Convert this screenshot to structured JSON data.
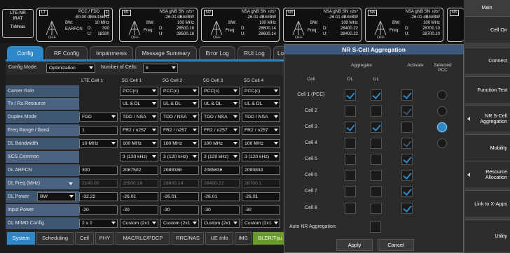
{
  "status": {
    "lte": {
      "line1": "LTE-NR",
      "line2": "IRAT",
      "line3": "TxMeas"
    },
    "pcc": {
      "tag": "LT",
      "title": "PCC / FDD",
      "badge": "1",
      "power": "-60.00 dBm/15kHz",
      "bw_label": "BW:",
      "bw": "10 MHz",
      "earfcn_label": "EARFCN",
      "d_label": "D:",
      "d": "300",
      "u_label": "U:",
      "u": "18300",
      "off": "OFF"
    },
    "cells": [
      {
        "tag": "N1",
        "title": "NSA gNB SN",
        "band": "n257",
        "power": "-26.01 dBm/BW",
        "bw_label": "BW:",
        "bw": "100 MHz",
        "freq_label": "Freq:",
        "d_label": "D:",
        "d": "28500.18",
        "u_label": "U:",
        "u": "28500.18",
        "off": "OFF"
      },
      {
        "tag": "N2",
        "title": "NSA gNB SN",
        "band": "n257",
        "power": "-26.01 dBm/BW",
        "bw_label": "BW:",
        "bw": "100 MHz",
        "freq_label": "Freq:",
        "d_label": "D:",
        "d": "28600.14",
        "u_label": "U:",
        "u": "28600.14",
        "off": "OFF"
      },
      {
        "tag": "N3",
        "title": "NSA gNB SN",
        "band": "n257",
        "power": "-26.01 dBm/BW",
        "bw_label": "BW:",
        "bw": "100 MHz",
        "freq_label": "Freq:",
        "d_label": "D:",
        "d": "28400.22",
        "u_label": "U:",
        "u": "28400.22",
        "off": "OFF"
      },
      {
        "tag": "N4",
        "title": "NSA gNB SN",
        "band": "n257",
        "power": "-26.01 dBm/BW",
        "bw_label": "BW:",
        "bw": "100 MHz",
        "freq_label": "Freq:",
        "d_label": "D:",
        "d": "28700.10",
        "u_label": "U:",
        "u": "28700.10",
        "off": "OFF"
      },
      {
        "tag": "N5"
      }
    ]
  },
  "tabs": [
    "Config",
    "RF Config",
    "Impairments",
    "Message Summary",
    "Error Log",
    "RUI Log",
    "Lo"
  ],
  "config": {
    "mode_label": "Config Mode:",
    "mode_value": "Optimization",
    "cells_label": "Number of Cells:",
    "cells_value": "8",
    "columns": [
      "LTE Cell 1",
      "5G Cell 1",
      "5G Cell 2",
      "5G Cell 3",
      "5G Cell 4"
    ],
    "rows": [
      {
        "label": "Carrier Role",
        "values": [
          "",
          "PCC(c)",
          "PCC(c)",
          "PCC(c)",
          "PCC(c)"
        ]
      },
      {
        "label": "Tx / Rx Resource",
        "values": [
          "",
          "UL & DL",
          "UL & DL",
          "UL & DL",
          "UL & DL"
        ]
      },
      {
        "label": "Duplex Mode",
        "values": [
          "FDD",
          "TDD / NSA",
          "TDD / NSA",
          "TDD / NSA",
          "TDD / NSA"
        ]
      },
      {
        "label": "Freq Range / Band",
        "values": [
          "1",
          "FR2 / n257",
          "FR2 / n257",
          "FR2 / n257",
          "FR2 / n257"
        ]
      },
      {
        "label": "DL Bandwidth",
        "values": [
          "10 MHz",
          "100 MHz",
          "100 MHz",
          "100 MHz",
          "100 MHz"
        ]
      },
      {
        "label": "SCS Common",
        "values": [
          "",
          "3 (120 kHz)",
          "3 (120 kHz)",
          "3 (120 kHz)",
          "3 (120 kHz)"
        ]
      },
      {
        "label": "DL ARFCN",
        "values": [
          "300",
          "2087502",
          "2089168",
          "2085836",
          "2090834"
        ]
      },
      {
        "label": "DL Freq (MHz)",
        "values": [
          "2140.00",
          "28500.18",
          "28600.14",
          "28400.22",
          "28700.1"
        ]
      },
      {
        "label": "DL Power",
        "unit": "BW",
        "values": [
          "-32.22",
          "-26.01",
          "-26.01",
          "-26.01",
          "-26.01"
        ]
      },
      {
        "label": "Input Power",
        "values": [
          "-20",
          "-30",
          "-30",
          "-30",
          "-30"
        ]
      },
      {
        "label": "DL MIMO Config",
        "values": [
          "2 x 2",
          "Custom (2x1",
          "Custom (2x1",
          "Custom (2x1",
          "Custom (2x1"
        ]
      }
    ]
  },
  "bottom_tabs": [
    "System",
    "Scheduling",
    "Cell",
    "PHY",
    "MAC/RLC/PDCP",
    "RRC/NAS",
    "UE Info",
    "IMS",
    "BLER/Tpu"
  ],
  "dialog": {
    "title": "NR S-Cell Aggregation",
    "headers": {
      "cell": "Cell",
      "aggregate": "Aggregate",
      "dl": "DL",
      "ul": "UL",
      "activate": "Activate",
      "selected": "Selected",
      "pcc": "PCC"
    },
    "rows": [
      {
        "cell": "Cell 1 (PCC)",
        "dl": true,
        "ul": true,
        "act": true,
        "act_dim": false,
        "pcc": false
      },
      {
        "cell": "Cell 2",
        "dl": false,
        "ul": false,
        "act": true,
        "act_dim": true,
        "pcc": false
      },
      {
        "cell": "Cell 3",
        "dl": true,
        "ul": true,
        "act": true,
        "act_dim": false,
        "pcc": true
      },
      {
        "cell": "Cell 4",
        "dl": false,
        "ul": false,
        "act": true,
        "act_dim": true,
        "pcc": false
      },
      {
        "cell": "Cell 5",
        "dl": false,
        "ul": false,
        "act": true,
        "act_dim": false,
        "pcc": false
      },
      {
        "cell": "Cell 6",
        "dl": false,
        "ul": false,
        "act": true,
        "act_dim": false,
        "pcc": false
      },
      {
        "cell": "Cell 7",
        "dl": false,
        "ul": false,
        "act": true,
        "act_dim": false,
        "pcc": false
      },
      {
        "cell": "Cell 8",
        "dl": false,
        "ul": false,
        "act": true,
        "act_dim": false,
        "pcc": false
      }
    ],
    "auto_label": "Auto NR Aggregation:",
    "apply": "Apply",
    "cancel": "Cancel"
  },
  "right_menu": {
    "title": "Main",
    "buttons": [
      {
        "label": "Cell On",
        "arrow": false
      },
      {
        "label": "Connect",
        "arrow": false
      },
      {
        "label": "Function Test",
        "arrow": false
      },
      {
        "label": "NR S-Cell Aggregation",
        "arrow": true
      },
      {
        "label": "Mobility",
        "arrow": false
      },
      {
        "label": "Resource Allocation",
        "arrow": true
      },
      {
        "label": "Link to X-Apps",
        "arrow": false
      },
      {
        "label": "Utility",
        "arrow": false
      }
    ]
  },
  "colors": {
    "accent": "#2f87c8",
    "row_label": "#3f5670",
    "green_tab": "#6a9a2a"
  }
}
